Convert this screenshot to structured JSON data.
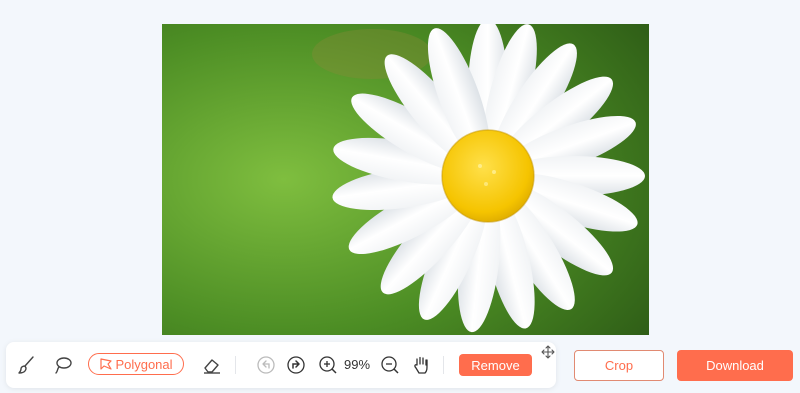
{
  "canvas": {
    "image_subject": "white daisy flower with yellow center on green background"
  },
  "toolbar": {
    "brush_icon": "brush-icon",
    "lasso_icon": "lasso-icon",
    "polygonal_label": "Polygonal",
    "polygonal_icon": "polygonal-icon",
    "eraser_icon": "eraser-icon",
    "undo_icon": "undo-icon",
    "redo_icon": "redo-icon",
    "zoom_in_icon": "zoom-in-icon",
    "zoom_level": "99%",
    "zoom_out_icon": "zoom-out-icon",
    "hand_icon": "hand-icon",
    "remove_label": "Remove"
  },
  "actions": {
    "crop_label": "Crop",
    "download_label": "Download"
  },
  "colors": {
    "accent": "#ff6d4d",
    "background": "#f3f7fc"
  }
}
